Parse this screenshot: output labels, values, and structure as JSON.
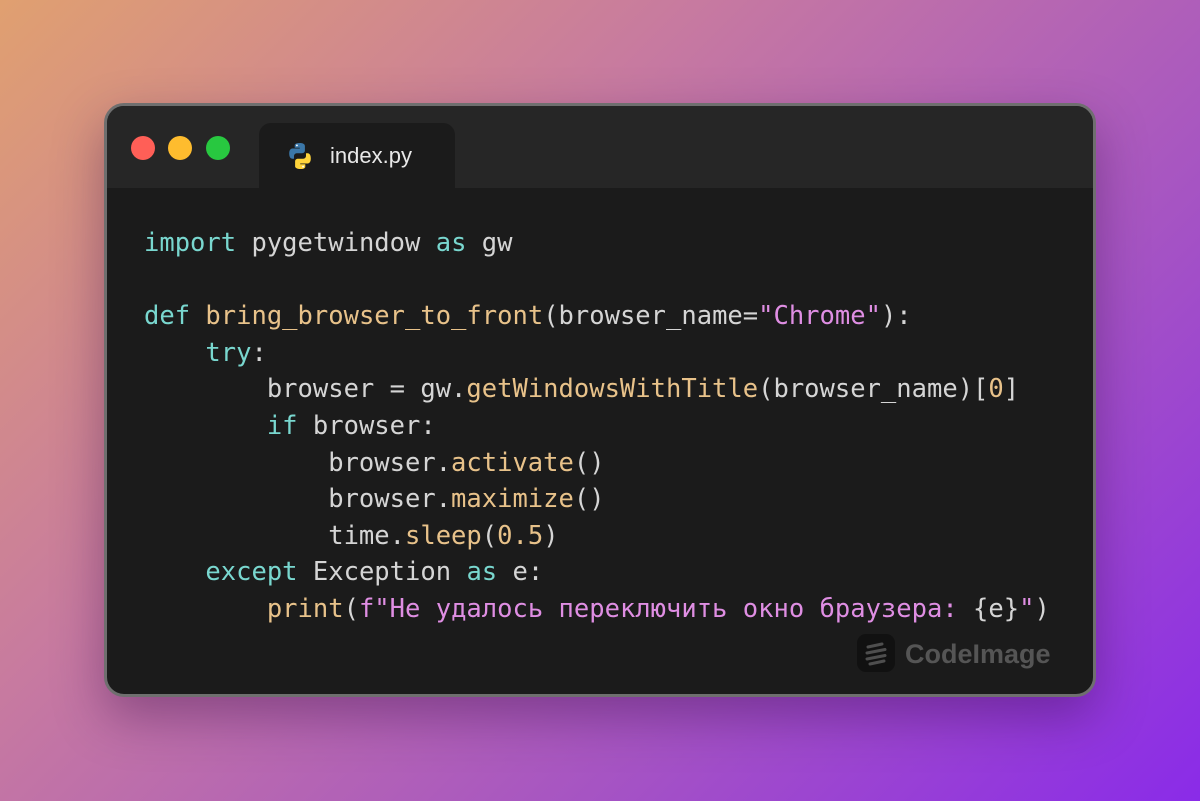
{
  "tab": {
    "filename": "index.py",
    "icon": "python-logo-icon"
  },
  "window_controls": [
    {
      "name": "close-dot",
      "color": "#ff5f57"
    },
    {
      "name": "minimize-dot",
      "color": "#febc2e"
    },
    {
      "name": "maximize-dot",
      "color": "#28c840"
    }
  ],
  "colors": {
    "keyword": "#79d7cf",
    "function": "#e8c28a",
    "string": "#df8ee3",
    "text": "#d5d5d5",
    "editor_background": "#1b1b1b",
    "titlebar_background": "#262626"
  },
  "code_lines": [
    [
      {
        "t": "import",
        "k": "kw"
      },
      {
        "t": " pygetwindow ",
        "k": "tx"
      },
      {
        "t": "as",
        "k": "kw"
      },
      {
        "t": " gw",
        "k": "tx"
      }
    ],
    [],
    [
      {
        "t": "def",
        "k": "kw"
      },
      {
        "t": " ",
        "k": "tx"
      },
      {
        "t": "bring_browser_to_front",
        "k": "fn"
      },
      {
        "t": "(browser_name=",
        "k": "tx"
      },
      {
        "t": "\"Chrome\"",
        "k": "st"
      },
      {
        "t": "):",
        "k": "tx"
      }
    ],
    [
      {
        "t": "    ",
        "k": "tx"
      },
      {
        "t": "try",
        "k": "kw"
      },
      {
        "t": ":",
        "k": "tx"
      }
    ],
    [
      {
        "t": "        browser = gw.",
        "k": "tx"
      },
      {
        "t": "getWindowsWithTitle",
        "k": "fn"
      },
      {
        "t": "(browser_name)[",
        "k": "tx"
      },
      {
        "t": "0",
        "k": "fn"
      },
      {
        "t": "]",
        "k": "tx"
      }
    ],
    [
      {
        "t": "        ",
        "k": "tx"
      },
      {
        "t": "if",
        "k": "kw"
      },
      {
        "t": " browser:",
        "k": "tx"
      }
    ],
    [
      {
        "t": "            browser.",
        "k": "tx"
      },
      {
        "t": "activate",
        "k": "fn"
      },
      {
        "t": "()",
        "k": "tx"
      }
    ],
    [
      {
        "t": "            browser.",
        "k": "tx"
      },
      {
        "t": "maximize",
        "k": "fn"
      },
      {
        "t": "()",
        "k": "tx"
      }
    ],
    [
      {
        "t": "            time.",
        "k": "tx"
      },
      {
        "t": "sleep",
        "k": "fn"
      },
      {
        "t": "(",
        "k": "tx"
      },
      {
        "t": "0.5",
        "k": "fn"
      },
      {
        "t": ")",
        "k": "tx"
      }
    ],
    [
      {
        "t": "    ",
        "k": "tx"
      },
      {
        "t": "except",
        "k": "kw"
      },
      {
        "t": " Exception ",
        "k": "tx"
      },
      {
        "t": "as",
        "k": "kw"
      },
      {
        "t": " e:",
        "k": "tx"
      }
    ],
    [
      {
        "t": "        ",
        "k": "tx"
      },
      {
        "t": "print",
        "k": "fn"
      },
      {
        "t": "(",
        "k": "tx"
      },
      {
        "t": "f\"Не удалось переключить окно браузера: ",
        "k": "st"
      },
      {
        "t": "{e}",
        "k": "tx"
      },
      {
        "t": "\"",
        "k": "st"
      },
      {
        "t": ")",
        "k": "tx"
      }
    ]
  ],
  "watermark": {
    "text": "CodeImage",
    "icon": "codeimage-logo-icon"
  }
}
